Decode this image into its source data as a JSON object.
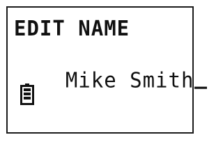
{
  "screen": {
    "title": "EDIT NAME",
    "name_value": "Mike Smith",
    "cursor_char": "_"
  },
  "status": {
    "battery_icon": "battery-icon",
    "battery_level": 1.0
  },
  "colors": {
    "foreground": "#111111",
    "background": "#ffffff",
    "border": "#1a1a1a"
  }
}
